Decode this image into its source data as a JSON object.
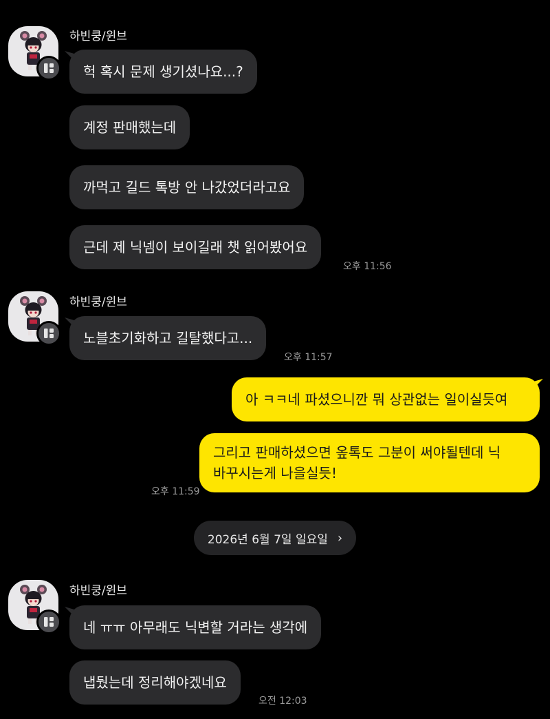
{
  "colors": {
    "background": "#000000",
    "incoming_bubble": "#2c2c2e",
    "outgoing_bubble": "#fee500",
    "time_text": "#9a9a9a"
  },
  "groups": [
    {
      "sender": "하빈쿵/윈브",
      "messages": [
        "헉 혹시 문제 생기셨나요...?",
        "계정 판매했는데",
        "까먹고 길드 톡방 안 나갔었더라고요",
        "근데 제 닉넴이 보이길래 챗 읽어봤어요"
      ],
      "time": "오후 11:56"
    },
    {
      "sender": "하빈쿵/윈브",
      "messages": [
        "노블초기화하고 길탈했다고..."
      ],
      "time": "오후 11:57"
    },
    {
      "sender": "하빈쿵/윈브",
      "messages": [
        "네 ㅠㅠ 아무래도 닉변할 거라는 생각에",
        "냅뒀는데 정리해야겠네요"
      ],
      "time": "오전 12:03"
    }
  ],
  "outgoing": {
    "messages": [
      "아 ㅋㅋ네 파셨으니깐 뭐 상관없는 일이실듯여",
      "그리고 판매하셨으면 옾톡도 그분이 써야될텐데 닉",
      "바꾸시는게 나을실듯!"
    ],
    "time": "오후 11:59"
  },
  "date_divider": {
    "label": "2026년 6월 7일 일요일",
    "icon": "chevron-right-icon"
  },
  "icons": {
    "avatar": "character-avatar",
    "badge": "profile-card-icon"
  }
}
